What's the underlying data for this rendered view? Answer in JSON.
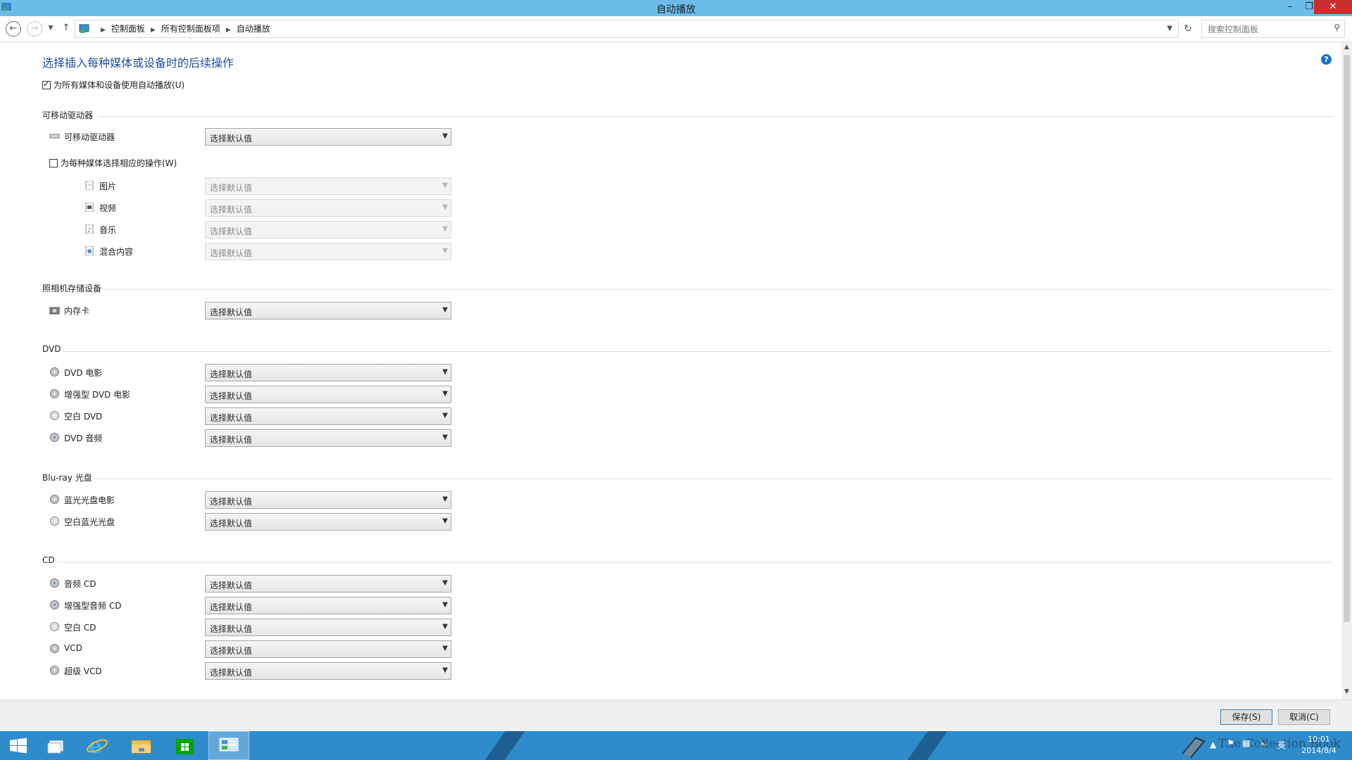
{
  "window": {
    "title": "自动播放",
    "minimize": "–",
    "restore": "❐",
    "close": "✕"
  },
  "address": {
    "breadcrumbs": [
      "控制面板",
      "所有控制面板项",
      "自动播放"
    ],
    "search_placeholder": "搜索控制面板"
  },
  "main": {
    "title": "选择插入每种媒体或设备时的后续操作",
    "use_autoplay_label": "为所有媒体和设备使用自动播放(U)",
    "use_autoplay_checked": true,
    "help": "?",
    "sections": {
      "removable": {
        "header": "可移动驱动器",
        "drive_label": "可移动驱动器",
        "drive_value": "选择默认值",
        "per_media_label": "为每种媒体选择相应的操作(W)",
        "per_media_checked": false,
        "items": [
          {
            "label": "图片",
            "value": "选择默认值"
          },
          {
            "label": "视频",
            "value": "选择默认值"
          },
          {
            "label": "音乐",
            "value": "选择默认值"
          },
          {
            "label": "混合内容",
            "value": "选择默认值"
          }
        ]
      },
      "camera": {
        "header": "照相机存储设备",
        "items": [
          {
            "label": "内存卡",
            "value": "选择默认值"
          }
        ]
      },
      "dvd": {
        "header": "DVD",
        "items": [
          {
            "label": "DVD 电影",
            "value": "选择默认值"
          },
          {
            "label": "增强型 DVD 电影",
            "value": "选择默认值"
          },
          {
            "label": "空白 DVD",
            "value": "选择默认值"
          },
          {
            "label": "DVD 音频",
            "value": "选择默认值"
          }
        ]
      },
      "bluray": {
        "header": "Blu-ray 光盘",
        "items": [
          {
            "label": "蓝光光盘电影",
            "value": "选择默认值"
          },
          {
            "label": "空白蓝光光盘",
            "value": "选择默认值"
          }
        ]
      },
      "cd": {
        "header": "CD",
        "items": [
          {
            "label": "音频 CD",
            "value": "选择默认值"
          },
          {
            "label": "增强型音频 CD",
            "value": "选择默认值"
          },
          {
            "label": "空白 CD",
            "value": "选择默认值"
          },
          {
            "label": "VCD",
            "value": "选择默认值"
          },
          {
            "label": "超级 VCD",
            "value": "选择默认值"
          }
        ]
      }
    }
  },
  "footer": {
    "save_label": "保存(S)",
    "cancel_label": "取消(C)"
  },
  "taskbar": {
    "ime": "英",
    "time": "10:01",
    "date": "2014/8/4",
    "watermark": "The Collection Book"
  },
  "colors": {
    "titlebar": "#6cbcea",
    "close": "#c8302e",
    "taskbar": "#2e8bcc",
    "heading": "#1e4fa0"
  }
}
